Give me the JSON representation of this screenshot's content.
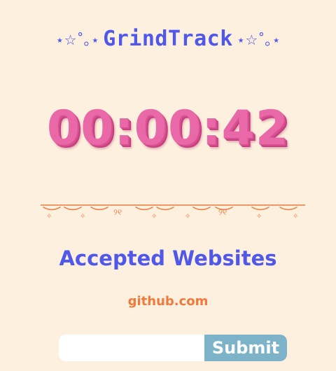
{
  "app": {
    "title": "GrindTrack",
    "title_deco_left": "⋆☆˚｡⋆",
    "title_deco_right": "⋆☆˚｡⋆"
  },
  "timer": {
    "display": "00:00:42"
  },
  "colors": {
    "background": "#fdf0de",
    "accent_blue": "#4f58e8",
    "timer_pink": "#e868a8",
    "divider_orange": "#ef7a3c",
    "button_teal": "#7db3c8"
  },
  "accepted": {
    "heading": "Accepted Websites",
    "sites": [
      "github.com"
    ]
  },
  "form": {
    "input_value": "",
    "input_placeholder": "",
    "submit_label": "Submit"
  }
}
